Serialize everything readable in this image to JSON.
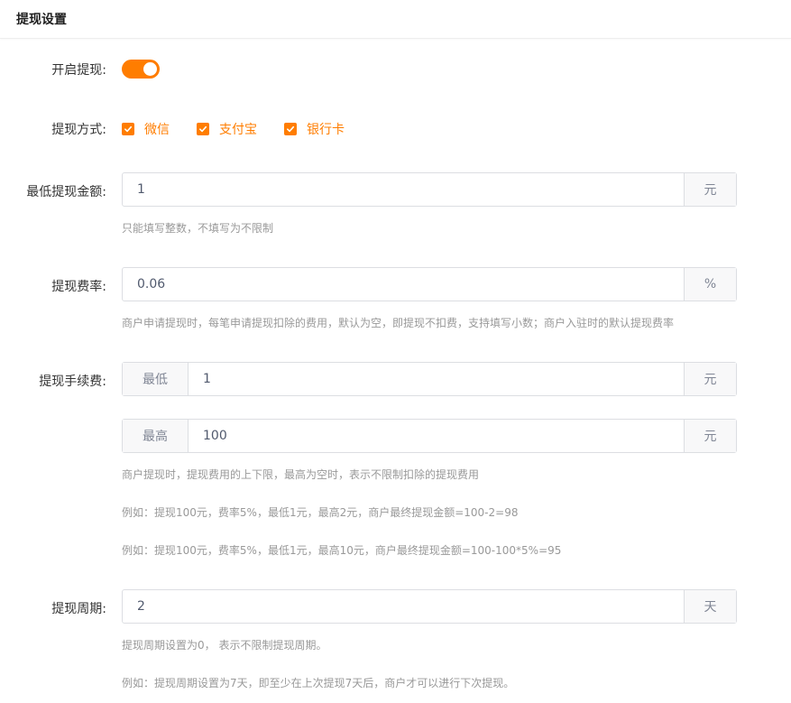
{
  "header": {
    "title": "提现设置"
  },
  "enable": {
    "label": "开启提现:",
    "on": true
  },
  "methods": {
    "label": "提现方式:",
    "options": [
      {
        "label": "微信",
        "checked": true
      },
      {
        "label": "支付宝",
        "checked": true
      },
      {
        "label": "银行卡",
        "checked": true
      }
    ]
  },
  "min_amount": {
    "label": "最低提现金额:",
    "value": "1",
    "unit": "元",
    "hint": "只能填写整数，不填写为不限制"
  },
  "fee_rate": {
    "label": "提现费率:",
    "value": "0.06",
    "unit": "%",
    "hint": "商户申请提现时，每笔申请提现扣除的费用，默认为空，即提现不扣费，支持填写小数；商户入驻时的默认提现费率"
  },
  "handling_fee": {
    "label": "提现手续费:",
    "min": {
      "prefix": "最低",
      "value": "1",
      "unit": "元"
    },
    "max": {
      "prefix": "最高",
      "value": "100",
      "unit": "元"
    },
    "hints": [
      "商户提现时，提现费用的上下限，最高为空时，表示不限制扣除的提现费用",
      "例如：提现100元，费率5%，最低1元，最高2元，商户最终提现金额=100-2=98",
      "例如：提现100元，费率5%，最低1元，最高10元，商户最终提现金额=100-100*5%=95"
    ]
  },
  "period": {
    "label": "提现周期:",
    "value": "2",
    "unit": "天",
    "hints": [
      "提现周期设置为0， 表示不限制提现周期。",
      "例如：提现周期设置为7天，即至少在上次提现7天后，商户才可以进行下次提现。"
    ]
  },
  "colors": {
    "accent": "#ff7d00",
    "hint_text": "#999999",
    "border": "#dcdee2",
    "addon_bg": "#f8f8f9"
  }
}
